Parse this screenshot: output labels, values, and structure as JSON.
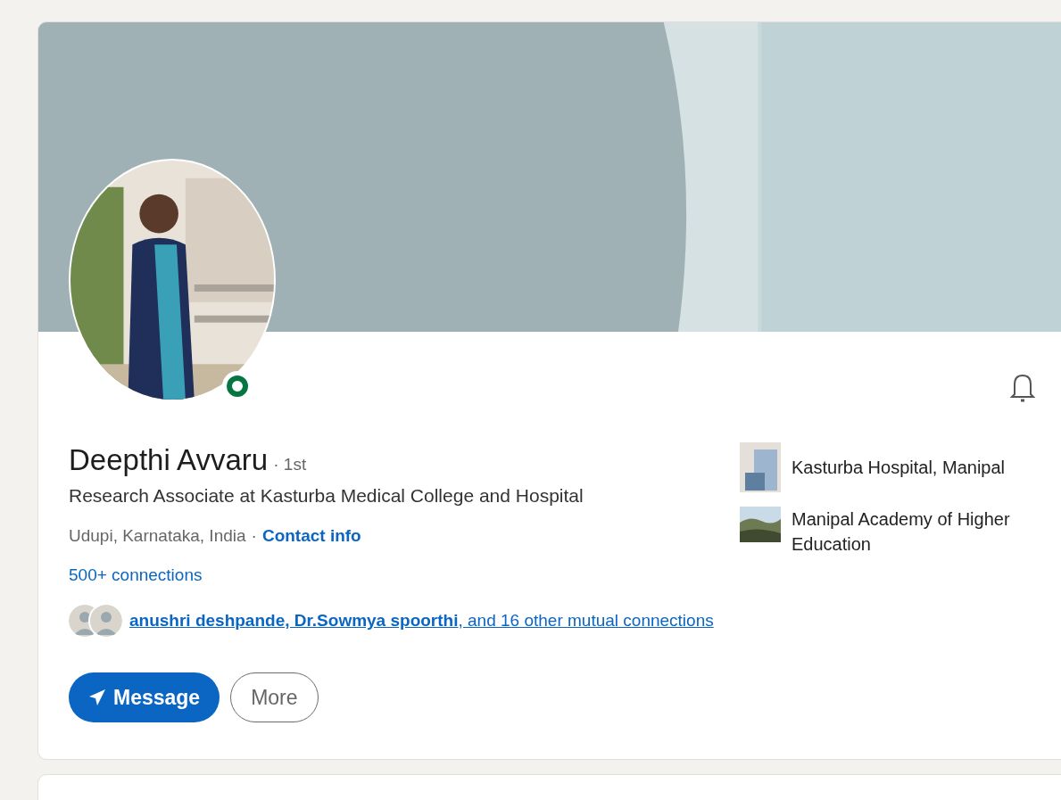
{
  "profile": {
    "name": "Deepthi Avvaru",
    "degree": "· 1st",
    "online": true,
    "headline": "Research Associate at Kasturba Medical College and Hospital",
    "location": "Udupi, Karnataka, India",
    "separator": "·",
    "contact_link": "Contact info",
    "connections": "500+ connections",
    "mutual": "**anushri deshpande, Dr.Sowmya spoorthi**, and 16 other mutual connections"
  },
  "affiliations": [
    {
      "kind": "building",
      "name": "Kasturba Hospital, Manipal"
    },
    {
      "name": "Manipal Academy of Higher Education"
    }
  ],
  "buttons": [
    {
      "kind": "primary",
      "label": "Message"
    },
    {
      "kind": "secondary",
      "label": "More"
    }
  ]
}
